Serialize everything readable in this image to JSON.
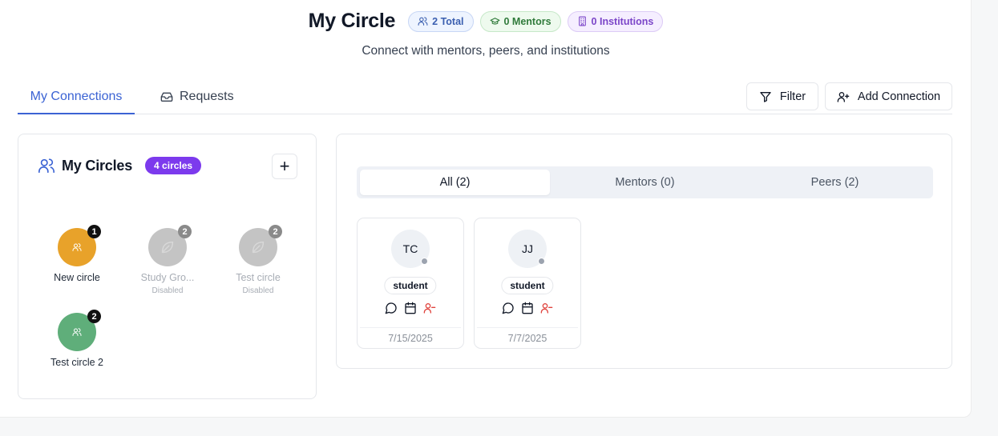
{
  "header": {
    "title": "My Circle",
    "subtitle": "Connect with mentors, peers, and institutions",
    "badges": {
      "total": "2 Total",
      "mentors": "0 Mentors",
      "institutions": "0 Institutions"
    }
  },
  "tabs": [
    {
      "label": "My Connections",
      "active": true
    },
    {
      "label": "Requests",
      "active": false
    }
  ],
  "actions": {
    "filter": "Filter",
    "add_connection": "Add Connection"
  },
  "circles": {
    "title": "My Circles",
    "count_badge": "4 circles",
    "items": [
      {
        "name": "New circle",
        "count": "1",
        "color": "#e8a22a",
        "status": ""
      },
      {
        "name": "Study Gro...",
        "count": "2",
        "color": "#c4c4c4",
        "status": "Disabled"
      },
      {
        "name": "Test circle",
        "count": "2",
        "color": "#c4c4c4",
        "status": "Disabled"
      },
      {
        "name": "Test circle 2",
        "count": "2",
        "color": "#5fae7a",
        "status": ""
      }
    ]
  },
  "filters": [
    {
      "label": "All (2)",
      "active": true
    },
    {
      "label": "Mentors (0)",
      "active": false
    },
    {
      "label": "Peers (2)",
      "active": false
    }
  ],
  "connections": [
    {
      "initials": "TC",
      "role": "student",
      "date": "7/15/2025"
    },
    {
      "initials": "JJ",
      "role": "student",
      "date": "7/7/2025"
    }
  ],
  "colors": {
    "accent": "#3b63d4",
    "circles_badge": "#7c3aed",
    "remove_icon": "#e0443e"
  }
}
